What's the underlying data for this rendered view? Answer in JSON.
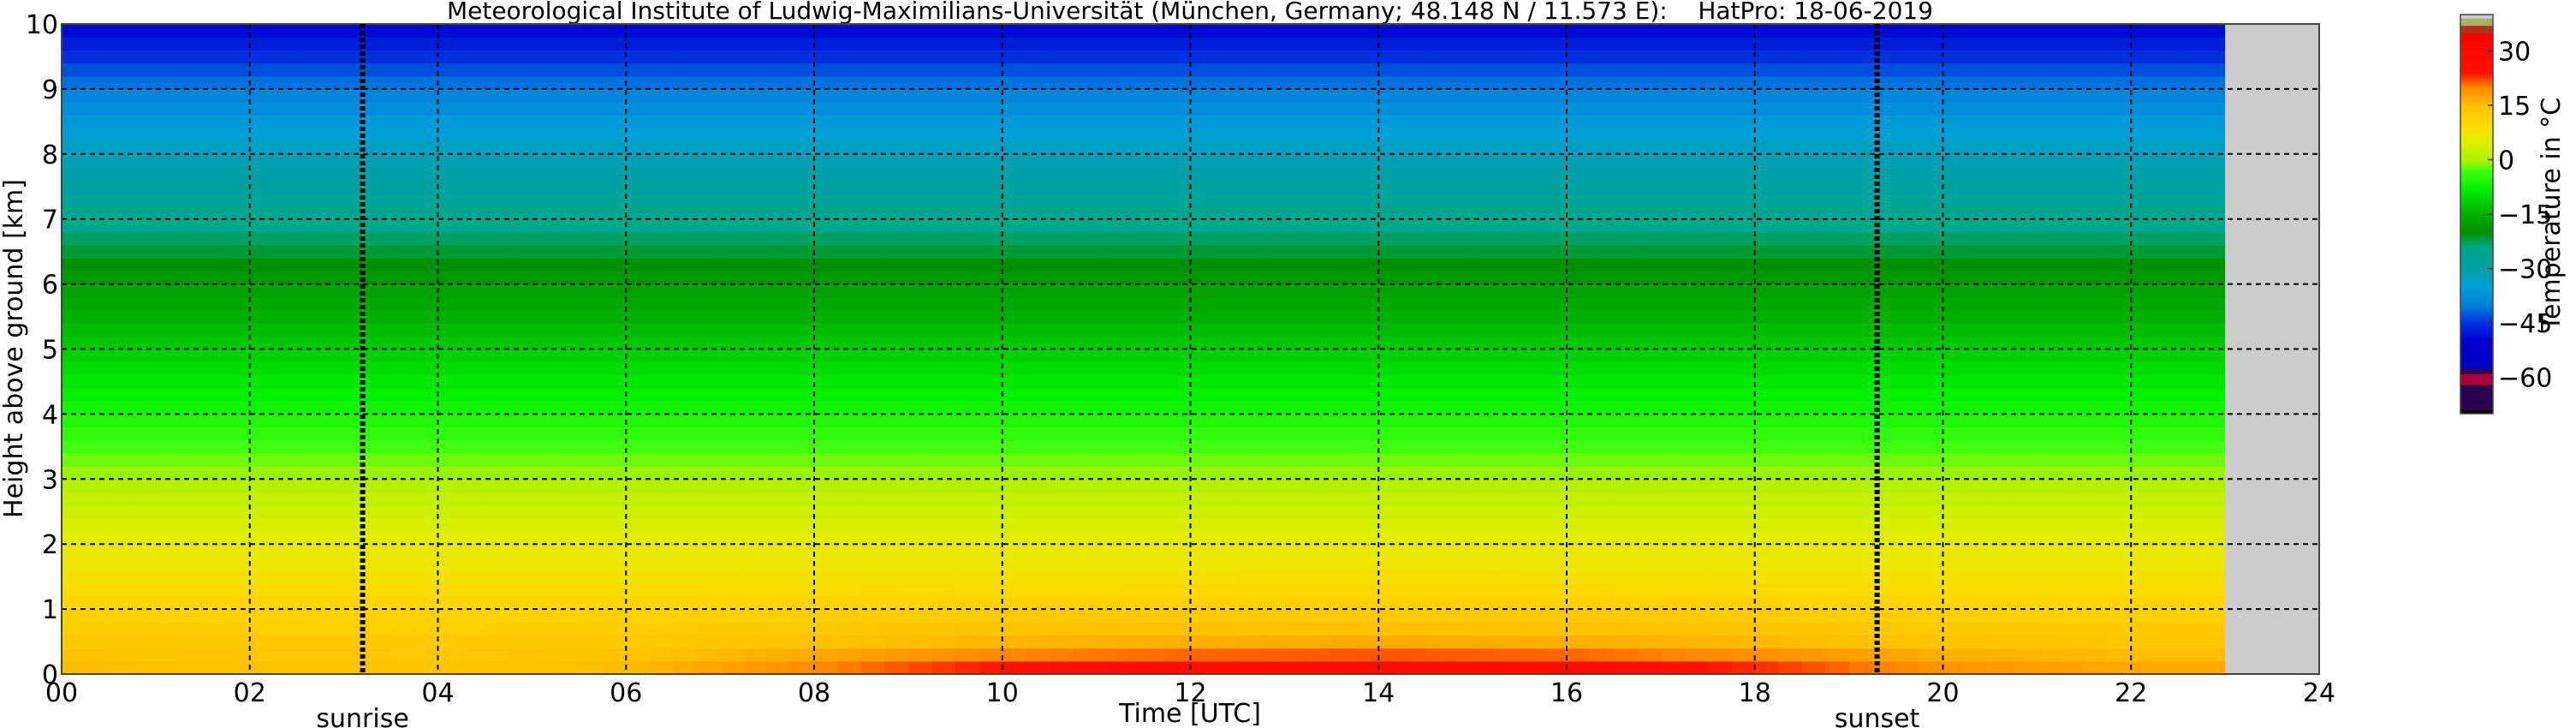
{
  "chart_data": {
    "type": "heatmap",
    "title": "Meteorological Institute of Ludwig-Maximilians-Universität (München, Germany; 48.148 N / 11.573 E):    HatPro: 18-06-2019",
    "xlabel": "Time [UTC]",
    "ylabel": "Height above ground [km]",
    "xlim": [
      0,
      24
    ],
    "ylim": [
      0,
      10
    ],
    "x_ticks": [
      "00",
      "02",
      "04",
      "06",
      "08",
      "10",
      "12",
      "14",
      "16",
      "18",
      "20",
      "22",
      "24"
    ],
    "y_ticks": [
      "0",
      "1",
      "2",
      "3",
      "4",
      "5",
      "6",
      "7",
      "8",
      "9",
      "10"
    ],
    "grid": true,
    "data_end_hour": 23,
    "annotations": [
      {
        "label": "sunrise",
        "hour": 3.2
      },
      {
        "label": "sunset",
        "hour": 19.3
      }
    ],
    "times_hours": [
      0,
      2,
      4,
      6,
      8,
      10,
      12,
      14,
      16,
      18,
      20,
      22,
      23
    ],
    "heights_km": [
      0,
      0.5,
      1,
      1.5,
      2,
      3,
      4,
      5,
      6,
      7,
      8,
      9,
      10
    ],
    "temperature_c": [
      [
        16,
        13,
        11,
        8,
        6,
        0,
        -6,
        -12,
        -18,
        -25,
        -32,
        -40,
        -50
      ],
      [
        15,
        12.7,
        10.9,
        8,
        6,
        0,
        -6,
        -12,
        -18,
        -25,
        -32,
        -40,
        -50
      ],
      [
        14.5,
        12.6,
        10.9,
        8,
        6,
        0,
        -6,
        -12,
        -18,
        -25,
        -32,
        -40,
        -50
      ],
      [
        16,
        13,
        11,
        8,
        6,
        0,
        -6,
        -12,
        -18,
        -25,
        -32,
        -40,
        -50
      ],
      [
        21,
        14.5,
        11.4,
        8.1,
        6,
        0,
        -6,
        -12,
        -18,
        -25,
        -32,
        -40,
        -50
      ],
      [
        26,
        15.9,
        11.8,
        8.2,
        6,
        0,
        -6,
        -12,
        -18,
        -25,
        -32,
        -40,
        -50
      ],
      [
        28,
        16.5,
        12,
        8.2,
        6,
        0,
        -6,
        -12,
        -18,
        -25,
        -32,
        -40,
        -50
      ],
      [
        29,
        16.8,
        12,
        8.3,
        6,
        0,
        -6,
        -12,
        -18,
        -25,
        -32,
        -40,
        -50
      ],
      [
        28,
        16.5,
        12,
        8.2,
        6,
        0,
        -6,
        -12,
        -18,
        -25,
        -32,
        -40,
        -50
      ],
      [
        25,
        15.6,
        11.7,
        8.2,
        6,
        0,
        -6,
        -12,
        -18,
        -25,
        -32,
        -40,
        -50
      ],
      [
        20,
        14.2,
        11.3,
        8.1,
        6,
        0,
        -6,
        -12,
        -18,
        -25,
        -32,
        -40,
        -50
      ],
      [
        18,
        13.6,
        11.2,
        8,
        6,
        0,
        -6,
        -12,
        -18,
        -25,
        -32,
        -40,
        -50
      ],
      [
        18,
        13.6,
        11.2,
        8,
        6,
        0,
        -6,
        -12,
        -18,
        -25,
        -32,
        -40,
        -50
      ]
    ],
    "colorbar": {
      "label": "Temperature in °C",
      "range": [
        -70,
        40
      ],
      "ticks": [
        "30",
        "15",
        "0",
        "−15",
        "−30",
        "−45",
        "−60"
      ],
      "tick_values": [
        30,
        15,
        0,
        -15,
        -30,
        -45,
        -60
      ]
    },
    "colors": {
      "missing": "#cccccc"
    }
  }
}
